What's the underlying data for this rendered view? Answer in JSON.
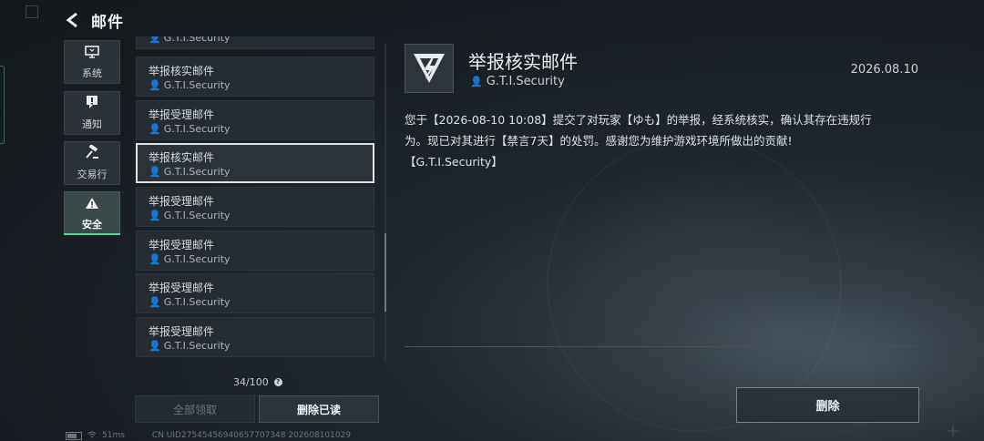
{
  "header": {
    "title": "邮件"
  },
  "tabs": [
    {
      "label": "系统",
      "icon": "monitor-icon"
    },
    {
      "label": "通知",
      "icon": "alert-message-icon"
    },
    {
      "label": "交易行",
      "icon": "gavel-icon"
    },
    {
      "label": "安全",
      "icon": "warning-triangle-icon",
      "active": true
    }
  ],
  "mail_list": {
    "items": [
      {
        "title": "",
        "sender": "G.T.I.Security"
      },
      {
        "title": "举报核实邮件",
        "sender": "G.T.I.Security"
      },
      {
        "title": "举报受理邮件",
        "sender": "G.T.I.Security"
      },
      {
        "title": "举报核实邮件",
        "sender": "G.T.I.Security",
        "selected": true
      },
      {
        "title": "举报受理邮件",
        "sender": "G.T.I.Security"
      },
      {
        "title": "举报受理邮件",
        "sender": "G.T.I.Security"
      },
      {
        "title": "举报受理邮件",
        "sender": "G.T.I.Security"
      },
      {
        "title": "举报受理邮件",
        "sender": "G.T.I.Security"
      }
    ],
    "count": "34/100",
    "claim_all_label": "全部领取",
    "delete_read_label": "删除已读"
  },
  "detail": {
    "title": "举报核实邮件",
    "sender": "G.T.I.Security",
    "date": "2026.08.10",
    "body_line1": "您于【2026-08-10 10:08】提交了对玩家【ゆも】的举报，经系统核实，确认其存在违规行",
    "body_line2": "为。现已对其进行【禁言7天】的处罚。感谢您为维护游戏环境所做出的贡献!",
    "body_line3": "【G.T.I.Security】",
    "delete_label": "删除"
  },
  "footer": {
    "ping": "51ms",
    "uid": "CN UID27545456940657707348 202608101029"
  },
  "colors": {
    "accent": "#5fd0a0",
    "background": "#171d22"
  }
}
